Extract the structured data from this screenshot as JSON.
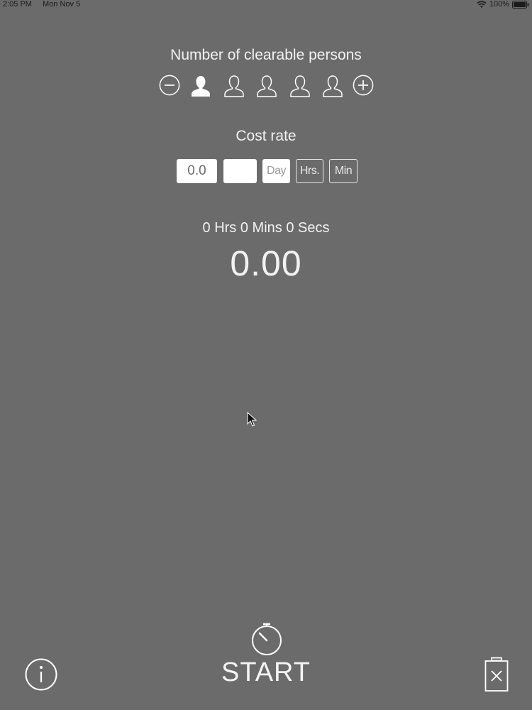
{
  "status_bar": {
    "time": "2:05 PM",
    "date": "Mon Nov 5",
    "battery": "100%"
  },
  "persons": {
    "title": "Number of clearable persons",
    "selected_count": 1,
    "max_count": 5
  },
  "cost_rate": {
    "title": "Cost rate",
    "amount_value": "0.0",
    "currency_value": "",
    "units": [
      "Day",
      "Hrs.",
      "Min"
    ],
    "selected_unit": "Day"
  },
  "timer": {
    "elapsed": "0 Hrs 0 Mins 0 Secs",
    "cost": "0.00"
  },
  "actions": {
    "start_label": "START"
  },
  "icons": {
    "minus": "minus-circle-icon",
    "plus": "plus-circle-icon",
    "person": "person-icon",
    "stopwatch": "stopwatch-icon",
    "info": "info-icon",
    "trash": "trash-icon"
  },
  "colors": {
    "background": "#6b6b6b",
    "foreground": "#ffffff"
  }
}
